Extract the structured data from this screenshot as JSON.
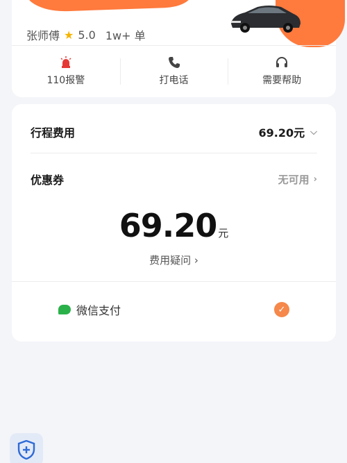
{
  "driver": {
    "name": "张师傅",
    "rating": "5.0",
    "orders": "1w+ 单"
  },
  "actions": [
    {
      "label": "110报警",
      "icon": "alarm-icon"
    },
    {
      "label": "打电话",
      "icon": "phone-icon"
    },
    {
      "label": "需要帮助",
      "icon": "headset-icon"
    }
  ],
  "fare": {
    "trip_label": "行程费用",
    "trip_value": "69.20元",
    "coupon_label": "优惠券",
    "coupon_value": "无可用",
    "total_amount": "69.20",
    "total_unit": "元",
    "question_label": "费用疑问 ›"
  },
  "payment": {
    "method": "微信支付",
    "selected": true
  },
  "colors": {
    "accent": "#f5884a",
    "wechat": "#2bb14a",
    "alarm": "#e53935"
  }
}
